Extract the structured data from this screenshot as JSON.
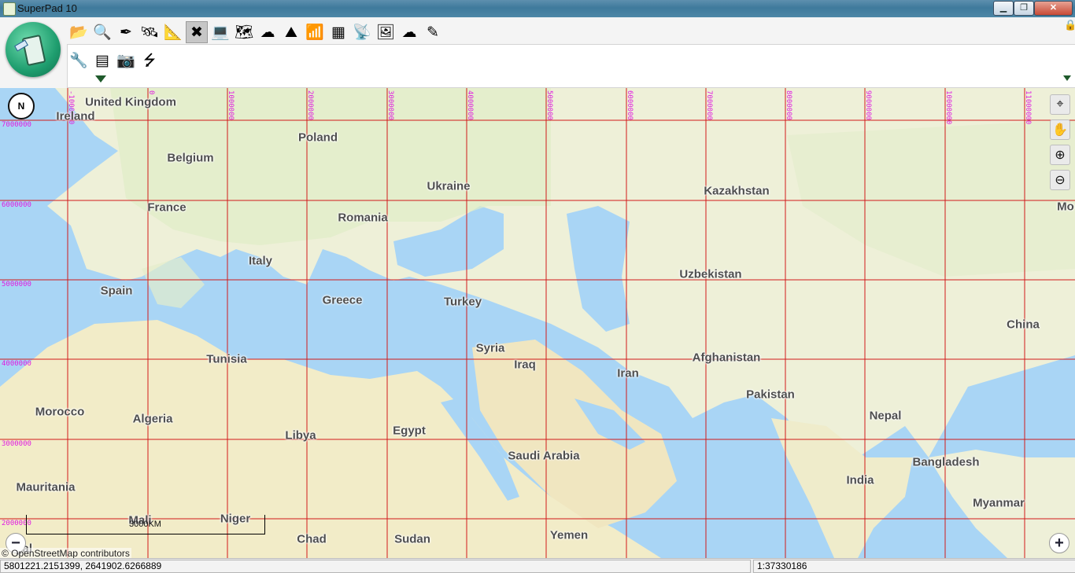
{
  "window": {
    "title": "SuperPad 10"
  },
  "toolbar": {
    "tools": [
      {
        "icon": "folder-icon",
        "glyph": "📂"
      },
      {
        "icon": "search-icon",
        "glyph": "🔍"
      },
      {
        "icon": "pen-icon",
        "glyph": "✒"
      },
      {
        "icon": "satellite-icon",
        "glyph": "🛰"
      },
      {
        "icon": "measure-icon",
        "glyph": "📐"
      },
      {
        "icon": "tools-cross-icon",
        "glyph": "✖"
      },
      {
        "icon": "laptop-icon",
        "glyph": "💻"
      },
      {
        "icon": "map-edit-icon",
        "glyph": "🗺"
      },
      {
        "icon": "cloud-sync-icon",
        "glyph": "☁"
      },
      {
        "icon": "terrain-icon",
        "glyph": "⛰"
      },
      {
        "icon": "signal-icon",
        "glyph": "📶"
      },
      {
        "icon": "grid-icon",
        "glyph": "▦"
      },
      {
        "icon": "tower-icon",
        "glyph": "📡"
      },
      {
        "icon": "image-map-icon",
        "glyph": "🖼"
      },
      {
        "icon": "cloud-icon",
        "glyph": "☁"
      },
      {
        "icon": "edit-pencil-icon",
        "glyph": "✎"
      }
    ],
    "tools_row2": [
      {
        "icon": "wrench-icon",
        "glyph": "🔧"
      },
      {
        "icon": "layout-icon",
        "glyph": "▤"
      },
      {
        "icon": "camera-icon",
        "glyph": "📷"
      },
      {
        "icon": "usb-icon",
        "glyph": "⭍"
      }
    ]
  },
  "map": {
    "countries": [
      {
        "name": "United Kingdom"
      },
      {
        "name": "Ireland"
      },
      {
        "name": "Poland"
      },
      {
        "name": "Belgium"
      },
      {
        "name": "Ukraine"
      },
      {
        "name": "Kazakhstan"
      },
      {
        "name": "France"
      },
      {
        "name": "Romania"
      },
      {
        "name": "Mo"
      },
      {
        "name": "Italy"
      },
      {
        "name": "Uzbekistan"
      },
      {
        "name": "Spain"
      },
      {
        "name": "Greece"
      },
      {
        "name": "Turkey"
      },
      {
        "name": "China"
      },
      {
        "name": "Syria"
      },
      {
        "name": "Tunisia"
      },
      {
        "name": "Iraq"
      },
      {
        "name": "Afghanistan"
      },
      {
        "name": "Iran"
      },
      {
        "name": "Pakistan"
      },
      {
        "name": "Morocco"
      },
      {
        "name": "Algeria"
      },
      {
        "name": "Nepal"
      },
      {
        "name": "Libya"
      },
      {
        "name": "Egypt"
      },
      {
        "name": "Saudi Arabia"
      },
      {
        "name": "Bangladesh"
      },
      {
        "name": "Mauritania"
      },
      {
        "name": "India"
      },
      {
        "name": "Myanmar"
      },
      {
        "name": "Mali"
      },
      {
        "name": "Niger"
      },
      {
        "name": "Chad"
      },
      {
        "name": "Sudan"
      },
      {
        "name": "Yemen"
      },
      {
        "name": "egal"
      }
    ],
    "grid_x_labels": [
      "-1000000",
      "0",
      "1000000",
      "2000000",
      "3000000",
      "4000000",
      "5000000",
      "6000000",
      "7000000",
      "8000000",
      "9000000",
      "10000000",
      "11000000"
    ],
    "grid_y_labels": [
      "7000000",
      "6000000",
      "5000000",
      "4000000",
      "3000000",
      "2000000"
    ],
    "grid_color": "#d11a1a",
    "grid_label_color": "#e01be0",
    "scale_label": "3000KM",
    "attribution": "© OpenStreetMap contributors",
    "north_label": "N",
    "controls": [
      {
        "icon": "locate-icon",
        "glyph": "⌖"
      },
      {
        "icon": "pan-hand-icon",
        "glyph": "✋"
      },
      {
        "icon": "zoom-in-icon",
        "glyph": "⊕"
      },
      {
        "icon": "zoom-out-icon",
        "glyph": "⊖"
      }
    ],
    "zoom_out_glyph": "−",
    "zoom_in_glyph": "+"
  },
  "status": {
    "coordinates": "5801221.2151399, 2641902.6266889",
    "scale": "1:37330186"
  }
}
